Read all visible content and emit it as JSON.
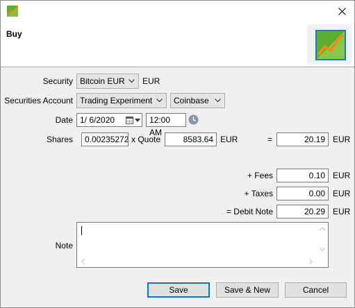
{
  "window": {
    "header_title": "Buy"
  },
  "form": {
    "security_label": "Security",
    "security_value": "Bitcoin EUR",
    "security_currency": "EUR",
    "account_label": "Securities Account",
    "account_value": "Trading Experiment",
    "account_broker": "Coinbase",
    "date_label": "Date",
    "date_value": "1/  6/2020",
    "time_value": "12:00 AM",
    "shares_label": "Shares",
    "shares_value": "0.00235272",
    "quote_label": "x Quote",
    "quote_value": "8583.64",
    "quote_currency": "EUR",
    "equals_label": "=",
    "gross_value": "20.19",
    "gross_currency": "EUR",
    "fees_label": "+ Fees",
    "fees_value": "0.10",
    "fees_currency": "EUR",
    "taxes_label": "+ Taxes",
    "taxes_value": "0.00",
    "taxes_currency": "EUR",
    "debit_label": "= Debit Note",
    "debit_value": "20.29",
    "debit_currency": "EUR",
    "note_label": "Note",
    "note_value": ""
  },
  "buttons": {
    "save": "Save",
    "save_new": "Save & New",
    "cancel": "Cancel"
  },
  "colors": {
    "accent": "#0078d7",
    "logo_green": "#5cae2c",
    "logo_orange": "#f28b1c"
  }
}
